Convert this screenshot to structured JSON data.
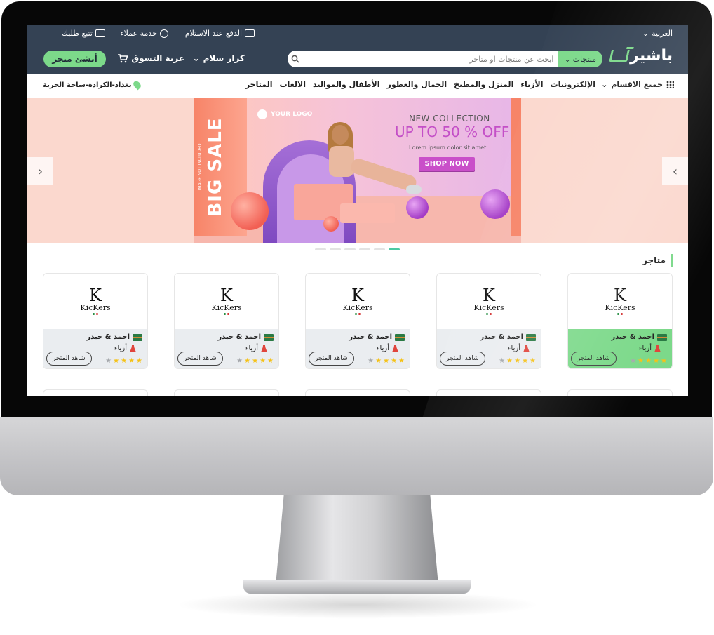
{
  "topbar": {
    "language": "العربية",
    "cod": "الدفع عند الاستلام",
    "support": "خدمة عملاء",
    "track": "تتبع طلبك"
  },
  "header": {
    "logo": "باشير",
    "search_category": "منتجات",
    "search_placeholder": "أبحث عن منتجات او متاجر",
    "user": "كرار سلام",
    "cart": "عربة التسوق",
    "create_store": "أنشئ متجر"
  },
  "catnav": {
    "all": "جميع الاقسام",
    "links": [
      "الإلكترونيات",
      "الأزياء",
      "المنزل والمطبخ",
      "الجمال والعطور",
      "الأطفال والمواليد",
      "الالعاب",
      "المتاجر"
    ],
    "location": "بغداد-الكرادة-ساحة الحرية"
  },
  "hero": {
    "logo_text": "YOUR LOGO",
    "sale": "BIG SALE",
    "sale_note": "IMAGE NOT INCLUDED",
    "title": "NEW COLLECTION",
    "headline": "UP TO 50 % OFF",
    "subtitle": "Lorem ipsum dolor sit amet",
    "cta": "SHOP NOW",
    "slides": 6,
    "active_slide": 6
  },
  "stores": {
    "title": "متاجر",
    "brand_letter": "K",
    "brand": "KicKers",
    "items": [
      {
        "name": "احمد & حيدر",
        "category": "أزياء",
        "rating": 4,
        "button": "شاهد المتجر"
      },
      {
        "name": "احمد & حيدر",
        "category": "أزياء",
        "rating": 4,
        "button": "شاهد المتجر"
      },
      {
        "name": "احمد & حيدر",
        "category": "أزياء",
        "rating": 4,
        "button": "شاهد المتجر"
      },
      {
        "name": "احمد & حيدر",
        "category": "أزياء",
        "rating": 4,
        "button": "شاهد المتجر"
      },
      {
        "name": "احمد & حيدر",
        "category": "أزياء",
        "rating": 4,
        "button": "شاهد المتجر"
      }
    ]
  },
  "colors": {
    "header_bg": "#344254",
    "accent_green": "#7cd98a",
    "promo_purple": "#c44fc7",
    "banner_bg": "#fbd8ce"
  },
  "icons": {
    "language": "chevron-down-icon",
    "cod": "cash-icon",
    "support": "headset-icon",
    "track": "truck-icon",
    "search": "search-icon",
    "cart": "cart-icon",
    "location": "pin-icon",
    "categories": "grid-icon"
  }
}
